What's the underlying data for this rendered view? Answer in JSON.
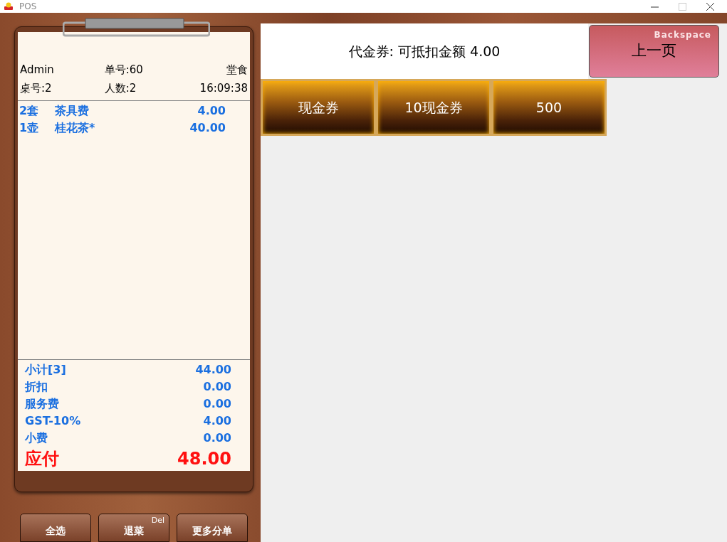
{
  "window": {
    "title": "POS"
  },
  "order": {
    "operator": "Admin",
    "order_no": "单号:60",
    "service_type": "堂食",
    "table": "桌号:2",
    "guests": "人数:2",
    "time": "16:09:38"
  },
  "items": [
    {
      "qty": "2套",
      "name": "茶具费",
      "amount": "4.00"
    },
    {
      "qty": "1壶",
      "name": "桂花茶*",
      "amount": "40.00"
    }
  ],
  "totals": [
    {
      "label": "小计[3]",
      "value": "44.00"
    },
    {
      "label": "折扣",
      "value": "0.00"
    },
    {
      "label": "服务费",
      "value": "0.00"
    },
    {
      "label": "GST-10%",
      "value": "4.00"
    },
    {
      "label": "小费",
      "value": "0.00"
    }
  ],
  "total_due": {
    "label": "应付",
    "value": "48.00"
  },
  "actions": [
    {
      "label": "全选"
    },
    {
      "label": "退菜",
      "shortcut": "Del"
    },
    {
      "label": "更多分单"
    }
  ],
  "voucher": {
    "title": "代金券: 可抵扣金额 4.00"
  },
  "back_button": {
    "label": "上一页",
    "shortcut": "Backspace"
  },
  "coupons": [
    {
      "label": "现金券"
    },
    {
      "label": "10现金券"
    },
    {
      "label": "500"
    }
  ]
}
